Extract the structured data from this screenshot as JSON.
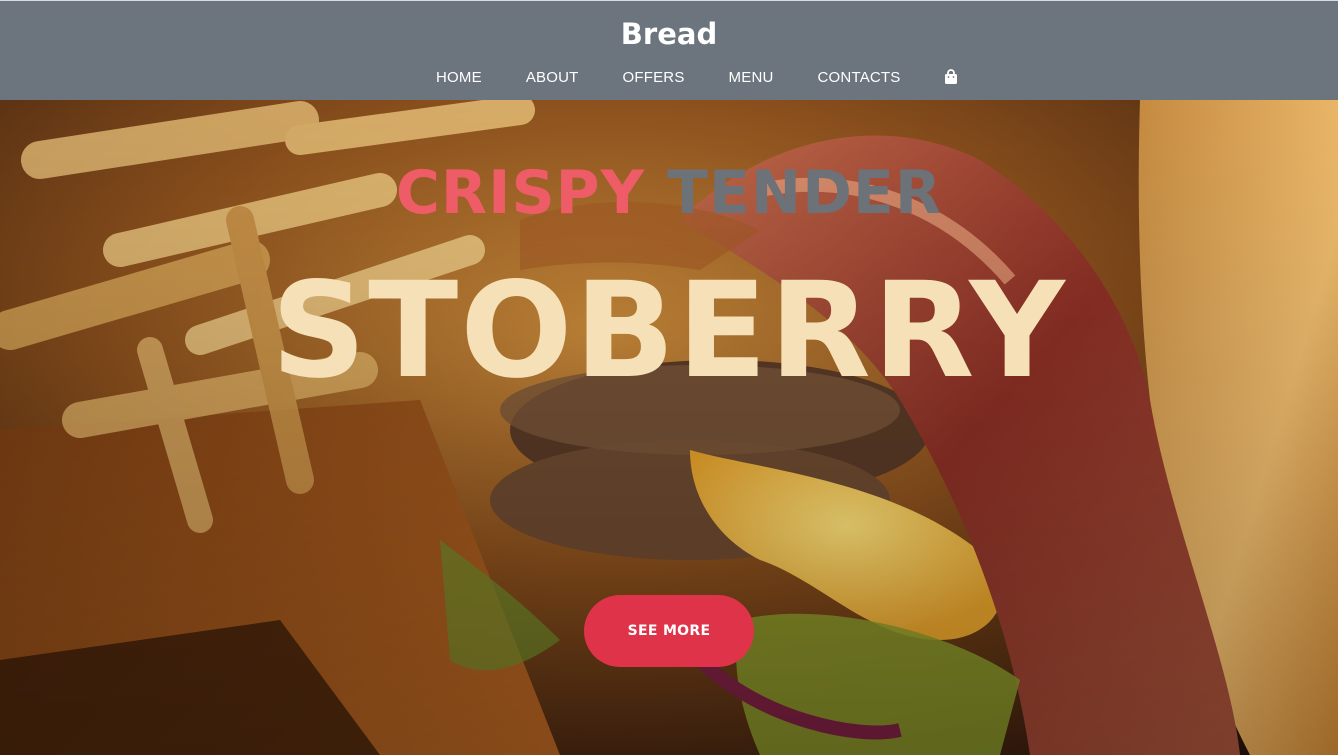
{
  "header": {
    "brand": "Bread",
    "nav": [
      {
        "label": "HOME"
      },
      {
        "label": "ABOUT"
      },
      {
        "label": "OFFERS"
      },
      {
        "label": "MENU"
      },
      {
        "label": "CONTACTS"
      }
    ],
    "cart_icon": "shopping-bag-icon"
  },
  "hero": {
    "tagline_word1": "CRISPY",
    "tagline_word2": "TENDER",
    "headline": "STOBERRY",
    "cta_label": "SEE MORE",
    "image": "burger-and-fries-photo"
  },
  "colors": {
    "header_bg": "#6c757d",
    "accent_red": "#df3349",
    "tagline_pink": "#ee5d67",
    "tagline_gray": "#6d7178",
    "headline_cream": "#f6e0b7"
  }
}
